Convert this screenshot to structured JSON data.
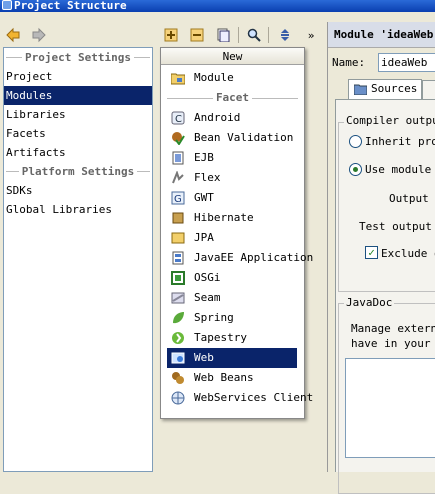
{
  "window": {
    "title": "Project Structure"
  },
  "left_panel": {
    "project_settings_header": "Project Settings",
    "project_items": [
      "Project",
      "Modules",
      "Libraries",
      "Facets",
      "Artifacts"
    ],
    "selected_item": "Modules",
    "platform_settings_header": "Platform Settings",
    "platform_items": [
      "SDKs",
      "Global Libraries"
    ]
  },
  "toolbar": {
    "more_label": "»"
  },
  "popup": {
    "title": "New",
    "module_item": "Module",
    "facet_header": "Facet",
    "facets": [
      {
        "label": "Android",
        "icon": "android-icon"
      },
      {
        "label": "Bean Validation",
        "icon": "bean-validation-icon"
      },
      {
        "label": "EJB",
        "icon": "ejb-icon"
      },
      {
        "label": "Flex",
        "icon": "flex-icon"
      },
      {
        "label": "GWT",
        "icon": "gwt-icon"
      },
      {
        "label": "Hibernate",
        "icon": "hibernate-icon"
      },
      {
        "label": "JPA",
        "icon": "jpa-icon"
      },
      {
        "label": "JavaEE Application",
        "icon": "javaee-icon"
      },
      {
        "label": "OSGi",
        "icon": "osgi-icon"
      },
      {
        "label": "Seam",
        "icon": "seam-icon"
      },
      {
        "label": "Spring",
        "icon": "spring-icon"
      },
      {
        "label": "Tapestry",
        "icon": "tapestry-icon"
      },
      {
        "label": "Web",
        "icon": "web-icon"
      },
      {
        "label": "Web Beans",
        "icon": "web-beans-icon"
      },
      {
        "label": "WebServices Client",
        "icon": "webservices-client-icon"
      }
    ],
    "selected_facet": "Web"
  },
  "right_panel": {
    "module_header": "Module 'ideaWeb",
    "name_label": "Name:",
    "name_value": "ideaWeb",
    "sources_tab": "Sources",
    "compiler_output_title": "Compiler outpu",
    "inherit_label": "Inherit proj",
    "use_module_label": "Use module c",
    "output_path_label": "Output p",
    "test_output_path_label": "Test output p",
    "exclude_label": "Exclude o",
    "javadoc_title": "JavaDoc",
    "javadoc_text_line1": "Manage externa",
    "javadoc_text_line2": "have in your m"
  },
  "colors": {
    "selection": "#0a246a",
    "window_bg": "#ece9d8",
    "titlebar": "#0a3fb0"
  }
}
